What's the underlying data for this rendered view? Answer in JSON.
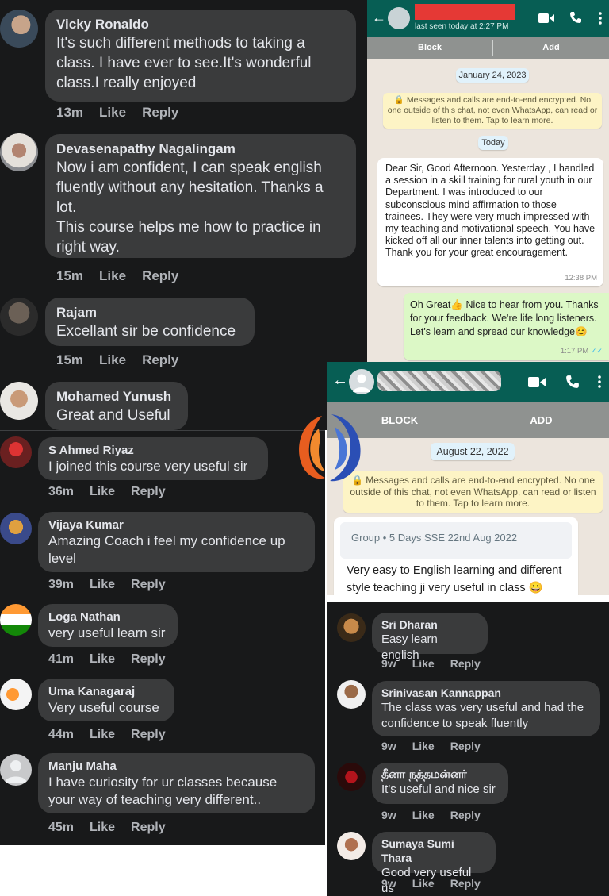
{
  "colors": {
    "fb_bg": "#18191a",
    "fb_bubble": "#3a3b3c",
    "fb_text": "#e4e6eb",
    "fb_muted": "#b0b3b8",
    "wa_header": "#075e54",
    "wa_bg": "#ece5dd",
    "wa_out_bubble": "#dcf8c6",
    "wa_read_ticks": "#34b7f1"
  },
  "fb_panel_1": {
    "comments": [
      {
        "name": "Vicky Ronaldo",
        "text": "It's such different methods to taking a\nclass. I have ever to see.It's wonderful\nclass.I really enjoyed",
        "time": "13m",
        "like": "Like",
        "reply": "Reply"
      },
      {
        "name": "Devasenapathy Nagalingam",
        "text": "Now i am  confident, I can speak english\nfluently without any hesitation. Thanks a\nlot.\nThis course helps me how to practice in\nright way.",
        "time": "15m",
        "like": "Like",
        "reply": "Reply"
      },
      {
        "name": "Rajam",
        "text": "Excellant sir be confidence",
        "time": "15m",
        "like": "Like",
        "reply": "Reply"
      },
      {
        "name": "Mohamed Yunush",
        "text": "Great and Useful",
        "time": "",
        "like": "",
        "reply": ""
      }
    ]
  },
  "fb_panel_2": {
    "comments": [
      {
        "name": "S Ahmed Riyaz",
        "text": "I joined this course  very useful sir",
        "time": "36m",
        "like": "Like",
        "reply": "Reply"
      },
      {
        "name": "Vijaya Kumar",
        "text": "Amazing Coach i feel my confidence up\nlevel",
        "time": "39m",
        "like": "Like",
        "reply": "Reply"
      },
      {
        "name": "Loga Nathan",
        "text": "very useful learn sir",
        "time": "41m",
        "like": "Like",
        "reply": "Reply"
      },
      {
        "name": "Uma Kanagaraj",
        "text": "Very useful course",
        "time": "44m",
        "like": "Like",
        "reply": "Reply"
      },
      {
        "name": "Manju Maha",
        "text": "I have curiosity for ur classes because\nyour way of teaching very different..",
        "time": "45m",
        "like": "Like",
        "reply": "Reply"
      }
    ]
  },
  "fb_panel_3": {
    "comments": [
      {
        "name": "Sri Dharan",
        "text": "Easy learn english",
        "time": "9w",
        "like": "Like",
        "reply": "Reply"
      },
      {
        "name": "Srinivasan Kannappan",
        "text": "The class was very useful and had the\nconfidence to speak fluently",
        "time": "9w",
        "like": "Like",
        "reply": "Reply"
      },
      {
        "name": "தீனா நத்தமன்னர்",
        "text": "It's useful and nice sir",
        "time": "9w",
        "like": "Like",
        "reply": "Reply"
      },
      {
        "name": "Sumaya Sumi Thara",
        "text": "Good very useful us",
        "time": "9w",
        "like": "Like",
        "reply": "Reply"
      }
    ]
  },
  "wa_chat_1": {
    "status": "last seen today at 2:27 PM",
    "block_label": "Block",
    "add_label": "Add",
    "date_chip": "January 24, 2023",
    "encryption_notice": "🔒 Messages and calls are end-to-end encrypted. No one outside of this chat, not even WhatsApp, can read or listen to them. Tap to learn more.",
    "today_chip": "Today",
    "incoming_text": "Dear Sir, Good Afternoon. Yesterday , I handled a session in a skill training for rural youth in our Department. I was introduced to our subconscious mind affirmation to those trainees. They were very much impressed with my teaching and motivational speech. You have kicked off all our inner talents into getting out. Thank you for your great encouragement.",
    "incoming_time": "12:38 PM",
    "outgoing_text": "Oh Great👍  Nice to hear from you. Thanks for your feedback. We're life long listeners. Let's learn and spread our knowledge😊",
    "outgoing_time": "1:17 PM",
    "read_ticks": "✓✓"
  },
  "wa_chat_2": {
    "block_label": "BLOCK",
    "add_label": "ADD",
    "date_chip": "August 22, 2022",
    "encryption_notice": "🔒 Messages and calls are end-to-end encrypted. No one outside of this chat, not even WhatsApp, can read or listen to them. Tap to learn more.",
    "group_ref": "Group • 5 Days SSE 22nd Aug 2022",
    "message_text": "Very easy to English learning and different style teaching ji very useful in class 😀"
  },
  "icons": {
    "back": "back-arrow-icon",
    "video": "video-call-icon",
    "phone": "voice-call-icon",
    "menu": "more-vert-icon",
    "logo": "brand-logo"
  }
}
